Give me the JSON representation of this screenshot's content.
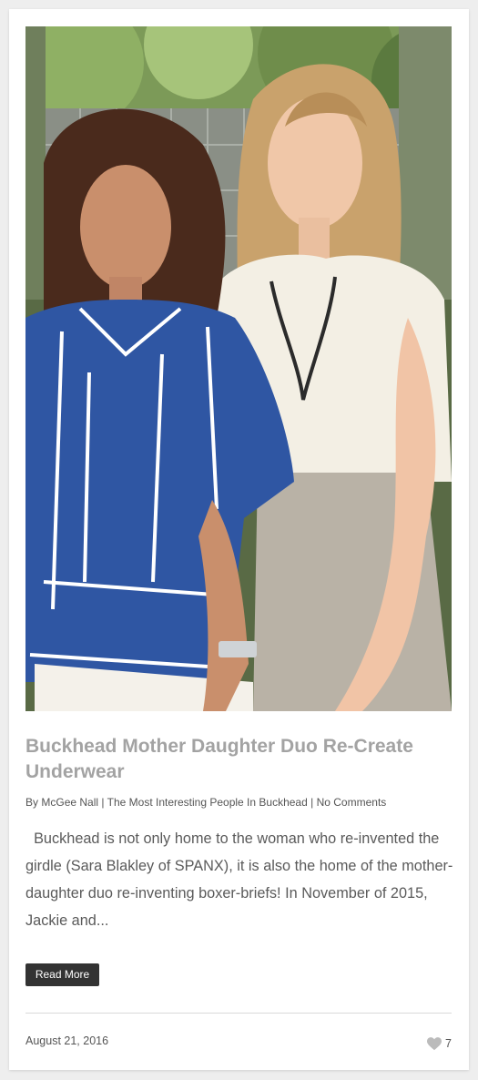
{
  "post": {
    "image_alt": "Mother and daughter standing together outdoors",
    "title": "Buckhead Mother Daughter Duo Re-Create Underwear",
    "meta": {
      "by_prefix": "By",
      "author": "McGee Nall",
      "category": "The Most Interesting People In Buckhead",
      "comments": "No Comments",
      "separator": "|"
    },
    "excerpt": "Buckhead is not only home to the woman who re-invented the girdle (Sara Blakley of SPANX), it is also the home of the mother-daughter duo re-inventing boxer-briefs! In November of 2015, Jackie and...",
    "read_more_label": "Read More",
    "date": "August 21, 2016",
    "likes": "7",
    "like_icon": "heart-icon"
  },
  "colors": {
    "title": "#a3a3a3",
    "button_bg": "#333333",
    "heart": "#bbbbbb"
  }
}
